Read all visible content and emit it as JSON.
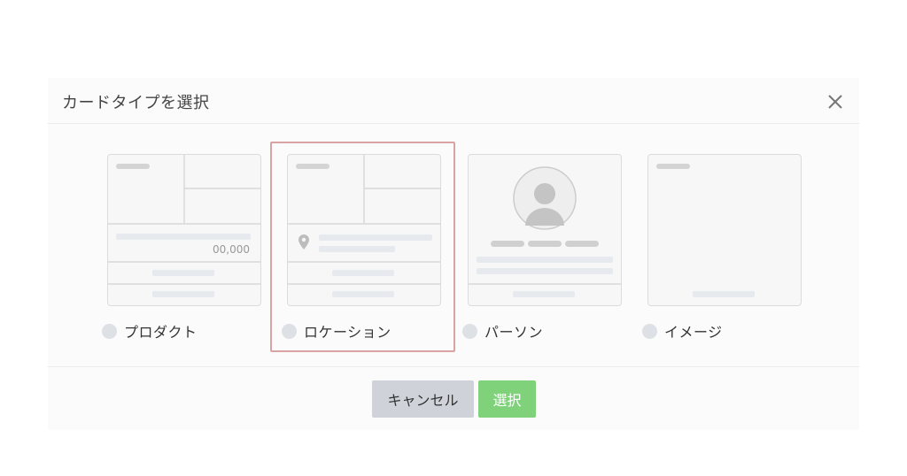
{
  "dialog": {
    "title": "カードタイプを選択",
    "close_icon": "close-icon"
  },
  "options": [
    {
      "id": "product",
      "label": "プロダクト",
      "price_placeholder": "00,000",
      "selected": false
    },
    {
      "id": "location",
      "label": "ロケーション",
      "selected": true
    },
    {
      "id": "person",
      "label": "パーソン",
      "selected": false
    },
    {
      "id": "image",
      "label": "イメージ",
      "selected": false
    }
  ],
  "footer": {
    "cancel_label": "キャンセル",
    "select_label": "選択"
  },
  "colors": {
    "selected_border": "#d9a3a3",
    "select_button": "#7fd27a",
    "cancel_button": "#cfd3d9"
  }
}
